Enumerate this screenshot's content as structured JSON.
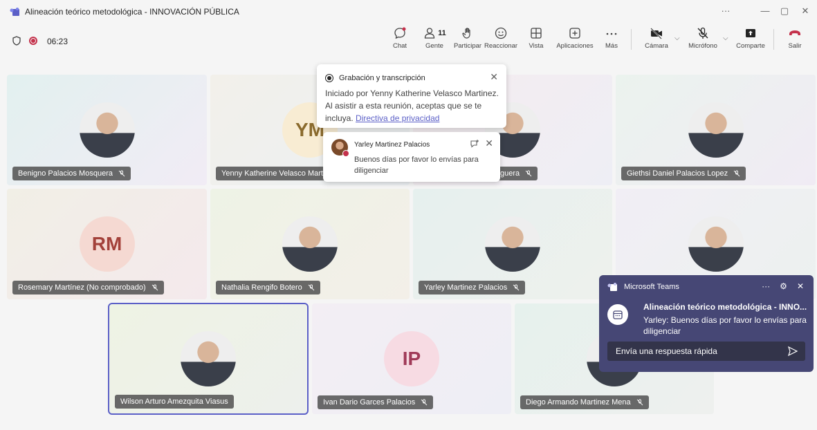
{
  "window": {
    "title": "Alineación teórico metodológica - INNOVACIÓN PÚBLICA",
    "more": "···",
    "minimize": "—",
    "restore": "▢",
    "close": "✕"
  },
  "meeting": {
    "timer": "06:23"
  },
  "toolbar": {
    "chat": "Chat",
    "people": "Gente",
    "people_count": "11",
    "raise": "Participar",
    "react": "Reaccionar",
    "view": "Vista",
    "apps": "Aplicaciones",
    "more": "Más",
    "camera": "Cámara",
    "mic": "Micrófono",
    "share": "Comparte",
    "leave": "Salir"
  },
  "participants": [
    {
      "name": "Benigno Palacios Mosquera",
      "type": "photo"
    },
    {
      "name": "Yenny Katherine Velasco Martinez",
      "initials": "YM",
      "type": "initials"
    },
    {
      "name": "guera",
      "type": "photo"
    },
    {
      "name": "Giethsi Daniel Palacios Lopez",
      "type": "photo"
    },
    {
      "name": "Rosemary Martínez (No comprobado)",
      "initials": "RM",
      "type": "initials"
    },
    {
      "name": "Nathalia Rengifo Botero",
      "type": "photo"
    },
    {
      "name": "Yarley Martinez Palacios",
      "type": "photo"
    },
    {
      "name": "",
      "type": "photo"
    },
    {
      "name": "Wilson Arturo Amezquita Viasus",
      "type": "photo"
    },
    {
      "name": "Ivan Dario Garces Palacios",
      "initials": "IP",
      "type": "initials"
    },
    {
      "name": "Diego Armando Martinez Mena",
      "type": "photo"
    }
  ],
  "recording_popup": {
    "title": "Grabación y transcripción",
    "body": "Iniciado por Yenny Katherine Velasco Martinez. Al asistir a esta reunión, aceptas que se te incluya.",
    "link": "Directiva de privacidad"
  },
  "chat_popup": {
    "sender": "Yarley Martinez Palacios",
    "message": "Buenos días por favor lo envías para diligenciar"
  },
  "toast": {
    "app": "Microsoft Teams",
    "title": "Alineación teórico metodológica - INNO...",
    "message": "Yarley: Buenos días por favor lo envías para diligenciar",
    "reply_placeholder": "Envía una respuesta rápida",
    "more": "···"
  },
  "colors": {
    "accent": "#5b5fc7",
    "record": "#c4314b",
    "toast_bg": "#464775",
    "leave": "#c4314b"
  }
}
